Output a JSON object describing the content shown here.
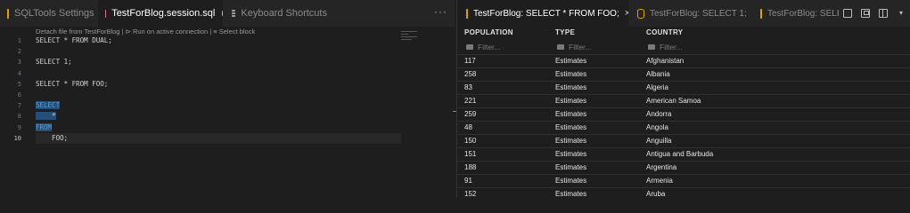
{
  "left_tabs": [
    {
      "label": "SQLTools Settings",
      "icon": "database-icon"
    },
    {
      "label": "TestForBlog.session.sql",
      "icon": "sql-file-icon",
      "modified": true
    },
    {
      "label": "Keyboard Shortcuts",
      "icon": "keyboard-icon"
    }
  ],
  "more_label": "···",
  "codelens": "Detach file from TestForBlog | ⊳ Run on active connection | ≡ Select block",
  "line_numbers": [
    "1",
    "2",
    "3",
    "4",
    "5",
    "6",
    "7",
    "8",
    "9",
    "10"
  ],
  "code_lines": [
    "SELECT * FROM DUAL;",
    "",
    "SELECT 1;",
    "",
    "SELECT * FROM FOO;",
    "",
    "SELECT",
    "    *",
    "FROM",
    "    FOO;"
  ],
  "right_tabs": [
    {
      "label": "TestForBlog: SELECT * FROM FOO;",
      "close": "×"
    },
    {
      "label": "TestForBlog: SELECT 1;"
    },
    {
      "label": "TestForBlog: SELECT"
    }
  ],
  "results": {
    "columns": [
      "POPULATION",
      "TYPE",
      "COUNTRY"
    ],
    "filter_placeholder": "Filter...",
    "rows": [
      [
        "117",
        "Estimates",
        "Afghanistan"
      ],
      [
        "258",
        "Estimates",
        "Albania"
      ],
      [
        "83",
        "Estimates",
        "Algeria"
      ],
      [
        "221",
        "Estimates",
        "American Samoa"
      ],
      [
        "259",
        "Estimates",
        "Andorra"
      ],
      [
        "48",
        "Estimates",
        "Angola"
      ],
      [
        "150",
        "Estimates",
        "Anguilla"
      ],
      [
        "151",
        "Estimates",
        "Antigua and Barbuda"
      ],
      [
        "188",
        "Estimates",
        "Argentina"
      ],
      [
        "91",
        "Estimates",
        "Armenia"
      ],
      [
        "152",
        "Estimates",
        "Aruba"
      ]
    ]
  },
  "colors": {
    "accent_db": "#d7a400",
    "keyword": "#569cd6",
    "selection": "#264f78"
  }
}
